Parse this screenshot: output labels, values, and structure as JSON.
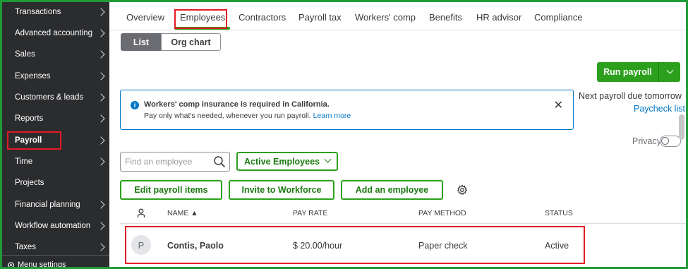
{
  "sidebar": {
    "items": [
      {
        "label": "Transactions"
      },
      {
        "label": "Advanced accounting"
      },
      {
        "label": "Sales"
      },
      {
        "label": "Expenses"
      },
      {
        "label": "Customers & leads"
      },
      {
        "label": "Reports"
      },
      {
        "label": "Payroll"
      },
      {
        "label": "Time"
      },
      {
        "label": "Projects"
      },
      {
        "label": "Financial planning"
      },
      {
        "label": "Workflow automation"
      },
      {
        "label": "Taxes"
      }
    ],
    "menu_settings": "Menu settings"
  },
  "tabs": [
    {
      "label": "Overview"
    },
    {
      "label": "Employees"
    },
    {
      "label": "Contractors"
    },
    {
      "label": "Payroll tax"
    },
    {
      "label": "Workers' comp"
    },
    {
      "label": "Benefits"
    },
    {
      "label": "HR advisor"
    },
    {
      "label": "Compliance"
    }
  ],
  "active_tab": "Employees",
  "view_toggle": {
    "list": "List",
    "org_chart": "Org chart"
  },
  "run_payroll": {
    "label": "Run payroll"
  },
  "banner": {
    "title": "Workers' comp insurance is required in California.",
    "body": "Pay only what's needed, whenever you run payroll.",
    "link": "Learn more"
  },
  "next_payroll": {
    "text": "Next payroll due tomorrow",
    "link": "Paycheck list"
  },
  "privacy": {
    "label": "Privacy",
    "enabled": false
  },
  "search": {
    "placeholder": "Find an employee",
    "value": ""
  },
  "filter": {
    "label": "Active Employees"
  },
  "actions": {
    "edit_payroll_items": "Edit payroll items",
    "invite_to_workforce": "Invite to Workforce",
    "add_employee": "Add an employee"
  },
  "table": {
    "headers": {
      "name": "NAME ▲",
      "pay_rate": "PAY RATE",
      "pay_method": "PAY METHOD",
      "status": "STATUS"
    },
    "rows": [
      {
        "initial": "P",
        "name": "Contis, Paolo",
        "pay_rate": "$ 20.00/hour",
        "pay_method": "Paper check",
        "status": "Active"
      }
    ]
  },
  "colors": {
    "accent_green": "#2ca01c",
    "sidebar_bg": "#2b2c2e",
    "link_blue": "#0077c5",
    "highlight_red": "#e21b24",
    "frame_green": "#1f9a3a"
  }
}
